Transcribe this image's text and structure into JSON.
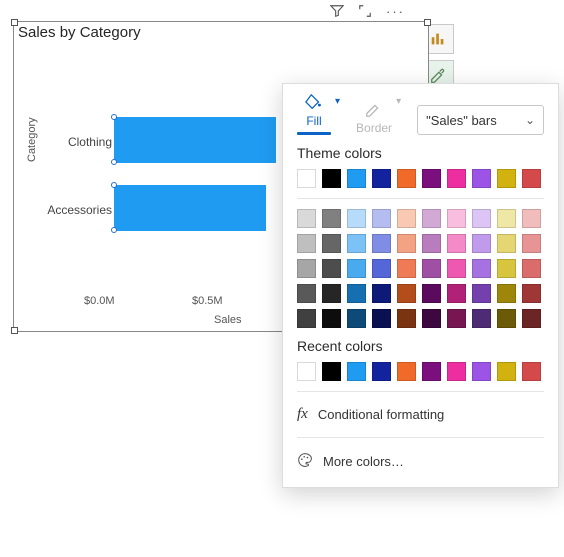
{
  "chart_data": {
    "type": "bar",
    "orientation": "horizontal",
    "title": "Sales by Category",
    "xlabel": "Sales",
    "ylabel": "Category",
    "categories": [
      "Clothing",
      "Accessories"
    ],
    "values": [
      0.75,
      0.7
    ],
    "units": "million USD",
    "x_ticks": [
      "$0.0M",
      "$0.5M"
    ],
    "bar_fill": "#1f9bf1"
  },
  "toolbar": {
    "filter_tooltip": "Filter",
    "focus_tooltip": "Focus mode",
    "more_tooltip": "More options"
  },
  "side_buttons": {
    "viz_picker_tooltip": "Visualizations",
    "formatting_tooltip": "Format"
  },
  "format_popup": {
    "tabs": {
      "fill": "Fill",
      "border": "Border"
    },
    "series_select": {
      "value": "\"Sales\" bars"
    },
    "theme_title": "Theme colors",
    "theme_colors_main": [
      "#ffffff",
      "#000000",
      "#1f9bf1",
      "#13239e",
      "#f06a2a",
      "#7a0f7d",
      "#ec2ea0",
      "#9b54e6",
      "#d2b20f",
      "#d44a4a"
    ],
    "theme_shades": [
      [
        "#d9d9d9",
        "#808080",
        "#b7dcfb",
        "#b5bdf0",
        "#f9c9b3",
        "#d2a8d4",
        "#f9bde0",
        "#dcc5f4",
        "#efe7a6",
        "#f0bcbc"
      ],
      [
        "#bfbfbf",
        "#666666",
        "#7cc2f7",
        "#7f8de4",
        "#f4a284",
        "#b97cbc",
        "#f48ac8",
        "#c19beb",
        "#e4d672",
        "#e69494"
      ],
      [
        "#a6a6a6",
        "#4d4d4d",
        "#4aaaee",
        "#5566d9",
        "#ee7b55",
        "#9f50a4",
        "#ee58b0",
        "#a672e2",
        "#d8c53e",
        "#db6c6c"
      ],
      [
        "#595959",
        "#262626",
        "#166fb0",
        "#0e1a78",
        "#b44d1c",
        "#5b0b5e",
        "#b12178",
        "#7440ad",
        "#9e860b",
        "#9f3737"
      ],
      [
        "#404040",
        "#0d0d0d",
        "#0e4a77",
        "#0a1152",
        "#7a3412",
        "#3d073f",
        "#771650",
        "#4e2b75",
        "#6b5a07",
        "#6c2525"
      ]
    ],
    "recent_title": "Recent colors",
    "recent_colors": [
      "#ffffff",
      "#000000",
      "#1f9bf1",
      "#13239e",
      "#f06a2a",
      "#7a0f7d",
      "#ec2ea0",
      "#9b54e6",
      "#d2b20f",
      "#d44a4a"
    ],
    "conditional_formatting": "Conditional formatting",
    "more_colors": "More colors…"
  }
}
